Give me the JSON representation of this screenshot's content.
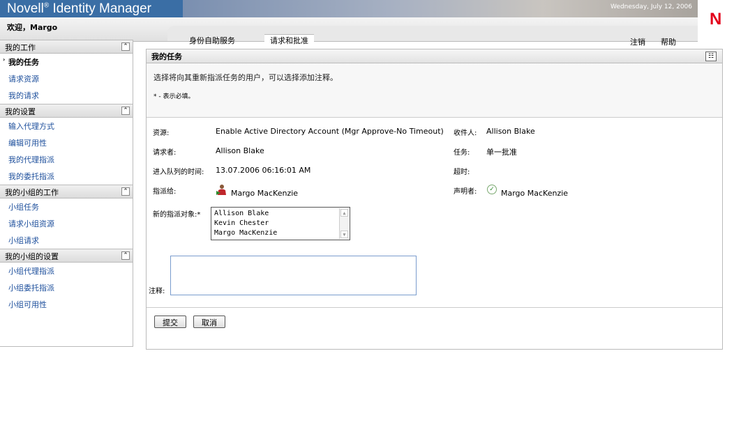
{
  "banner": {
    "product_name": "Novell",
    "product_reg": "®",
    "product_suffix": " Identity Manager",
    "date": "Wednesday, July 12, 2006",
    "welcome": "欢迎，Margo",
    "logo_letter": "N",
    "brand_red": "#e3001b"
  },
  "tabs": [
    {
      "label": "身份自助服务"
    },
    {
      "label": "请求和批准"
    }
  ],
  "toplinks": {
    "logout": "注销",
    "help": "帮助"
  },
  "sidebar": {
    "sections": [
      {
        "title": "我的工作",
        "items": [
          "我的任务",
          "请求资源",
          "我的请求"
        ]
      },
      {
        "title": "我的设置",
        "items": [
          "输入代理方式",
          "编辑可用性",
          "我的代理指派",
          "我的委托指派"
        ]
      },
      {
        "title": "我的小组的工作",
        "items": [
          "小组任务",
          "请求小组资源",
          "小组请求"
        ]
      },
      {
        "title": "我的小组的设置",
        "items": [
          "小组代理指派",
          "小组委托指派",
          "小组可用性"
        ]
      }
    ]
  },
  "main": {
    "title": "我的任务",
    "description": "选择将向其重新指派任务的用户，可以选择添加注释。",
    "required_note": "* - 表示必填。",
    "labels": {
      "resource": "资源:",
      "requester": "请求者:",
      "queued_time": "进入队列的时间:",
      "assigned_to": "指派给:",
      "new_assignee": "新的指派对象:*",
      "recipient": "收件人:",
      "task": "任务:",
      "timeout": "超时:",
      "claimant": "声明者:",
      "comment": "注释:"
    },
    "values": {
      "resource": "Enable Active Directory Account (Mgr Approve-No Timeout)",
      "requester": "Allison Blake",
      "queued_time": "13.07.2006 06:16:01 AM",
      "assigned_to": "Margo MacKenzie",
      "recipient": "Allison Blake",
      "task": "单一批准",
      "timeout": "",
      "claimant": "Margo MacKenzie"
    },
    "assignee_options": [
      "Allison Blake",
      "Kevin Chester",
      "Margo MacKenzie"
    ],
    "comment_value": "",
    "buttons": {
      "submit": "提交",
      "cancel": "取消"
    }
  }
}
